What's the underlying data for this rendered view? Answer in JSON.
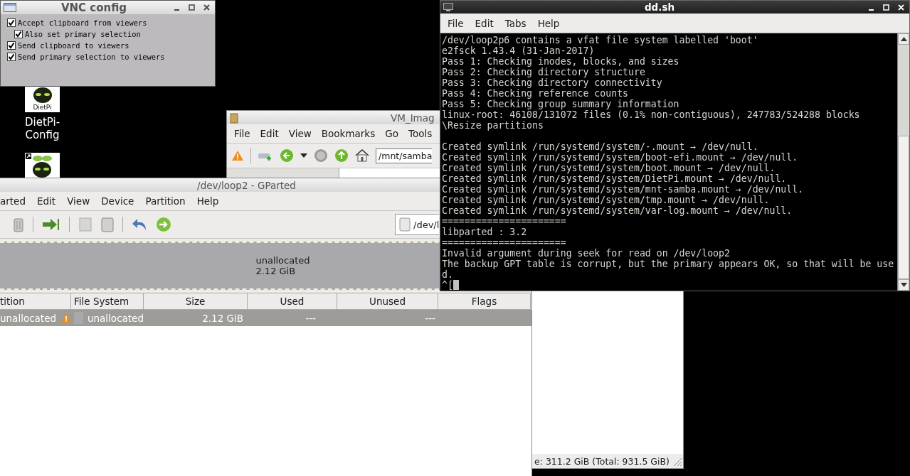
{
  "desktop": {
    "icons": [
      {
        "kind": "logo",
        "label": "DietPi-Config",
        "logo_text": "DietPi"
      },
      {
        "kind": "shortcut"
      }
    ]
  },
  "vnc_config": {
    "title": "VNC config",
    "options": [
      {
        "label": "Accept clipboard from viewers",
        "checked": true,
        "children": [
          {
            "label": "Also set primary selection",
            "checked": true
          }
        ]
      },
      {
        "label": "Send clipboard to viewers",
        "checked": true
      },
      {
        "label": "Send primary selection to viewers",
        "checked": true
      }
    ]
  },
  "file_manager": {
    "title": "VM_Imag",
    "menu": [
      "File",
      "Edit",
      "View",
      "Bookmarks",
      "Go",
      "Tools"
    ],
    "path": "/mnt/samba",
    "status": "e: 311.2 GiB (Total: 931.5 GiB)"
  },
  "gparted": {
    "title": "/dev/loop2 - GParted",
    "menu": [
      "arted",
      "Edit",
      "View",
      "Device",
      "Partition",
      "Help"
    ],
    "device": "/dev/l",
    "disk_map": {
      "label": "unallocated",
      "size": "2.12 GiB"
    },
    "table": {
      "columns": [
        "tition",
        "File System",
        "Size",
        "Used",
        "Unused",
        "Flags"
      ],
      "rows": [
        {
          "selected": true,
          "partition": "unallocated",
          "warning": true,
          "file_system": "unallocated",
          "size": "2.12 GiB",
          "used": "---",
          "unused": "---"
        }
      ]
    }
  },
  "terminal": {
    "title": "dd.sh",
    "menu": [
      "File",
      "Edit",
      "Tabs",
      "Help"
    ],
    "lines": [
      {
        "kind": "line",
        "text": "/dev/loop2p6 contains a vfat file system labelled 'boot'"
      },
      {
        "kind": "line",
        "text": "e2fsck 1.43.4 (31-Jan-2017)"
      },
      {
        "kind": "line",
        "text": "Pass 1: Checking inodes, blocks, and sizes"
      },
      {
        "kind": "line",
        "text": "Pass 2: Checking directory structure"
      },
      {
        "kind": "line",
        "text": "Pass 3: Checking directory connectivity"
      },
      {
        "kind": "line",
        "text": "Pass 4: Checking reference counts"
      },
      {
        "kind": "line",
        "text": "Pass 5: Checking group summary information"
      },
      {
        "kind": "line",
        "text": "linux-root: 46108/131072 files (0.1% non-contiguous), 247783/524288 blocks"
      },
      {
        "kind": "line",
        "text": "\\Resize partitions"
      },
      {
        "kind": "blank"
      },
      {
        "kind": "line",
        "text": "Created symlink /run/systemd/system/-.mount → /dev/null."
      },
      {
        "kind": "line",
        "text": "Created symlink /run/systemd/system/boot-efi.mount → /dev/null."
      },
      {
        "kind": "line",
        "text": "Created symlink /run/systemd/system/boot.mount → /dev/null."
      },
      {
        "kind": "line",
        "text": "Created symlink /run/systemd/system/DietPi.mount → /dev/null."
      },
      {
        "kind": "line",
        "text": "Created symlink /run/systemd/system/mnt-samba.mount → /dev/null."
      },
      {
        "kind": "line",
        "text": "Created symlink /run/systemd/system/tmp.mount → /dev/null."
      },
      {
        "kind": "line",
        "text": "Created symlink /run/systemd/system/var-log.mount → /dev/null."
      },
      {
        "kind": "line",
        "text": "======================"
      },
      {
        "kind": "line",
        "text": "libparted : 3.2"
      },
      {
        "kind": "line",
        "text": "======================"
      },
      {
        "kind": "line",
        "text": "Invalid argument during seek for read on /dev/loop2"
      },
      {
        "kind": "line",
        "text": "The backup GPT table is corrupt, but the primary appears OK, so that will be use"
      },
      {
        "kind": "line",
        "text": "d."
      },
      {
        "kind": "prompt",
        "text": "^["
      }
    ]
  }
}
